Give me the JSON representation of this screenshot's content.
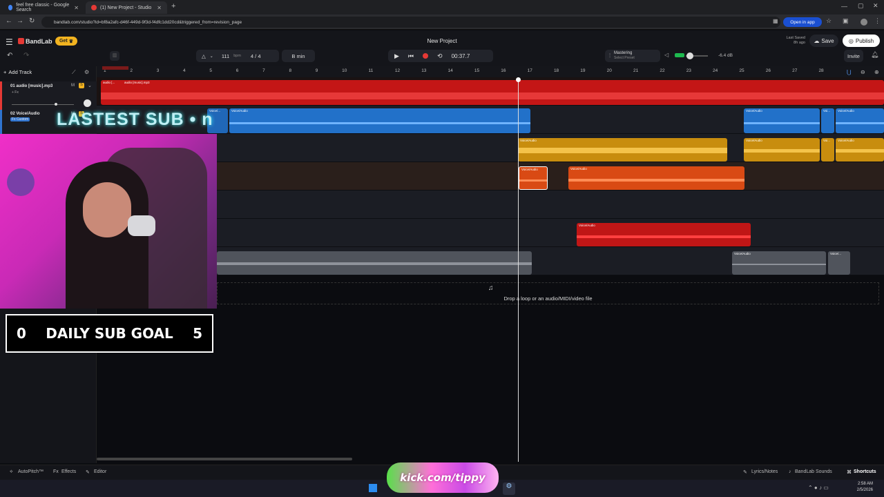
{
  "browser": {
    "tabs": [
      {
        "title": "feel free classic - Google Search",
        "color": "#4285f4"
      },
      {
        "title": "(1) New Project - Studio",
        "color": "#e53935"
      }
    ],
    "new_tab": "+",
    "url": "bandlab.com/studio?id=bf8a2afc-d46f-449d-9f3d-f4dfc1dd20cd&triggered_from=revision_page",
    "open_in_app": "Open in app"
  },
  "app": {
    "brand": "BandLab",
    "get_label": "Get",
    "project_title": "New Project",
    "last_saved_label": "Last Saved",
    "last_saved_time": "8h ago",
    "save_label": "Save",
    "publish_label": "Publish",
    "invite_label": "Invite",
    "tempo": "111",
    "tempo_unit": "bpm",
    "time_signature": "4 / 4",
    "key": "B min",
    "time": "00:37.7",
    "mastering_label": "Mastering",
    "mastering_preset": "Select Preset",
    "volume_db": "-6.4 dB",
    "accent": "#e53935"
  },
  "tracks_panel": {
    "add_track": "Add Track",
    "tracks": [
      {
        "name": "01  audio [music].mp3",
        "fx": "+ Fx",
        "mute": "M",
        "solo": "S"
      },
      {
        "name": "02  Voice/Audio",
        "fx": "Fx Custom",
        "mute": "M",
        "solo": "S"
      }
    ]
  },
  "ruler": [
    "1",
    "2",
    "3",
    "4",
    "5",
    "6",
    "7",
    "8",
    "9",
    "10",
    "11",
    "12",
    "13",
    "14",
    "15",
    "16",
    "17",
    "18",
    "19",
    "20",
    "21",
    "22",
    "23",
    "24",
    "25",
    "26",
    "27",
    "28"
  ],
  "clips": {
    "music_a": "audio [...",
    "music_b": "audio [music].mp3",
    "voice": "Voice/Audio",
    "voice_short": "Voice/...",
    "voice_tiny": "Voi..."
  },
  "drop_zone": "Drop a loop or an audio/MIDI/video file",
  "overlay": {
    "latest_sub": "LASTEST SUB • n",
    "goal_current": "0",
    "goal_label": "DAILY SUB GOAL",
    "goal_target": "5",
    "kick": "kick.com/tippy"
  },
  "bottom": {
    "autopitch": "AutoPitch™",
    "effects": "Effects",
    "editor": "Editor",
    "lyrics": "Lyrics/Notes",
    "sounds": "BandLab Sounds",
    "shortcuts": "Shortcuts"
  },
  "taskbar": {
    "time": "2:58 AM",
    "date": "2/5/2026"
  }
}
